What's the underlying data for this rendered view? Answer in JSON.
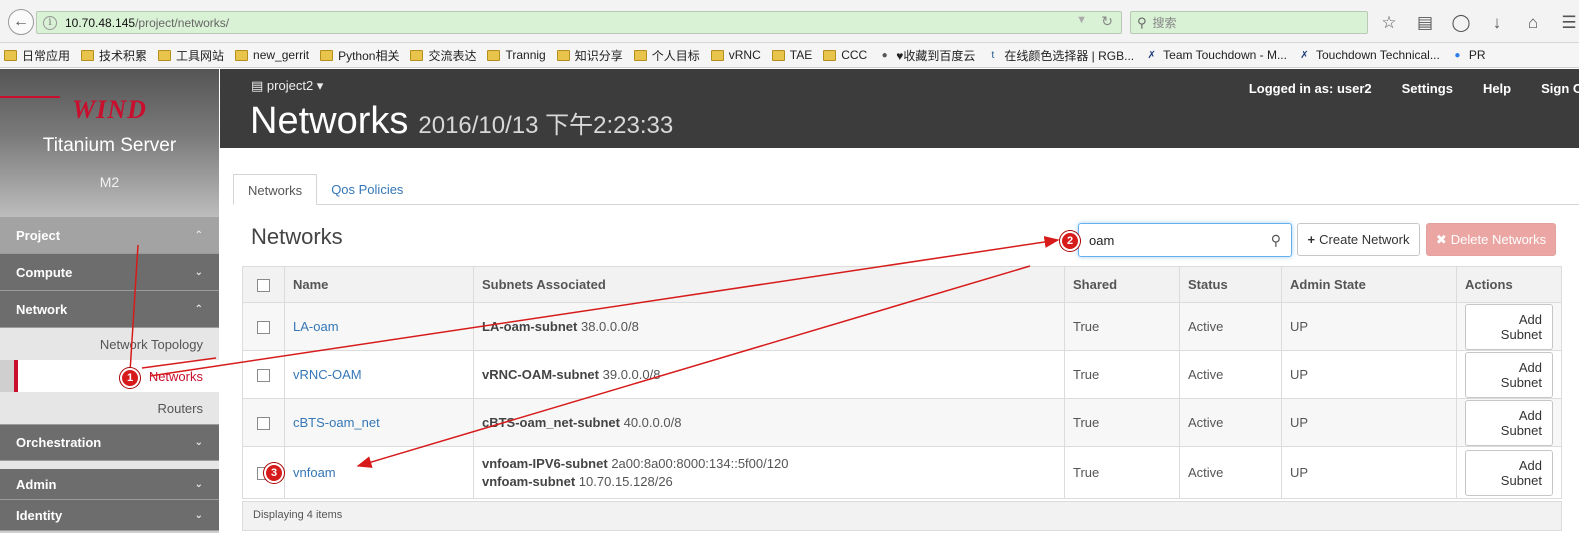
{
  "browser": {
    "url_host": "10.70.48.145",
    "url_path": "/project/networks/",
    "search_placeholder": "搜索",
    "bookmarks": [
      {
        "label": "日常应用",
        "icon": "folder-icon"
      },
      {
        "label": "技术积累",
        "icon": "folder-icon"
      },
      {
        "label": "工具网站",
        "icon": "folder-icon"
      },
      {
        "label": "new_gerrit",
        "icon": "folder-icon"
      },
      {
        "label": "Python相关",
        "icon": "folder-icon"
      },
      {
        "label": "交流表达",
        "icon": "folder-icon"
      },
      {
        "label": "Trannig",
        "icon": "folder-icon"
      },
      {
        "label": "知识分享",
        "icon": "folder-icon"
      },
      {
        "label": "个人目标",
        "icon": "folder-icon"
      },
      {
        "label": "vRNC",
        "icon": "folder-icon"
      },
      {
        "label": "TAE",
        "icon": "folder-icon"
      },
      {
        "label": "CCC",
        "icon": "folder-icon"
      },
      {
        "label": "♥收藏到百度云",
        "icon": "globe-icon"
      },
      {
        "label": "在线颜色选择器 | RGB...",
        "icon": "t-icon"
      },
      {
        "label": "Team Touchdown - M...",
        "icon": "x-icon"
      },
      {
        "label": "Touchdown Technical...",
        "icon": "x-icon"
      },
      {
        "label": "PR",
        "icon": "blue-icon"
      }
    ]
  },
  "sidebar": {
    "logo": "WIND",
    "product": "Titanium Server",
    "region": "M2",
    "project": "Project",
    "compute": "Compute",
    "network": "Network",
    "network_items": [
      "Network Topology",
      "Networks",
      "Routers"
    ],
    "orchestration": "Orchestration",
    "admin": "Admin",
    "identity": "Identity"
  },
  "header": {
    "project_selector": "project2",
    "title": "Networks",
    "timestamp": "2016/10/13 下午2:23:33",
    "logged_in": "Logged in as: user2",
    "settings": "Settings",
    "help": "Help",
    "sign_out": "Sign O"
  },
  "tabs": [
    "Networks",
    "Qos Policies"
  ],
  "section_title": "Networks",
  "filter_value": "oam",
  "create_button": "Create Network",
  "delete_button": "Delete Networks",
  "table": {
    "headers": [
      "Name",
      "Subnets Associated",
      "Shared",
      "Status",
      "Admin State",
      "Actions"
    ],
    "rows": [
      {
        "name": "LA-oam",
        "subnets": [
          {
            "name": "LA-oam-subnet",
            "cidr": "38.0.0.0/8"
          }
        ],
        "shared": "True",
        "status": "Active",
        "admin": "UP",
        "action": "Add Subnet"
      },
      {
        "name": "vRNC-OAM",
        "subnets": [
          {
            "name": "vRNC-OAM-subnet",
            "cidr": "39.0.0.0/8"
          }
        ],
        "shared": "True",
        "status": "Active",
        "admin": "UP",
        "action": "Add Subnet"
      },
      {
        "name": "cBTS-oam_net",
        "subnets": [
          {
            "name": "cBTS-oam_net-subnet",
            "cidr": "40.0.0.0/8"
          }
        ],
        "shared": "True",
        "status": "Active",
        "admin": "UP",
        "action": "Add Subnet"
      },
      {
        "name": "vnfoam",
        "subnets": [
          {
            "name": "vnfoam-IPV6-subnet",
            "cidr": "2a00:8a00:8000:134::5f00/120"
          },
          {
            "name": "vnfoam-subnet",
            "cidr": "10.70.15.128/26"
          }
        ],
        "shared": "True",
        "status": "Active",
        "admin": "UP",
        "action": "Add Subnet"
      }
    ],
    "footer": "Displaying 4 items"
  },
  "annotations": [
    "1",
    "2",
    "3"
  ],
  "colors": {
    "accent_red": "#c8102e",
    "link_blue": "#3577b6",
    "annotation_red": "#d71b1b"
  }
}
